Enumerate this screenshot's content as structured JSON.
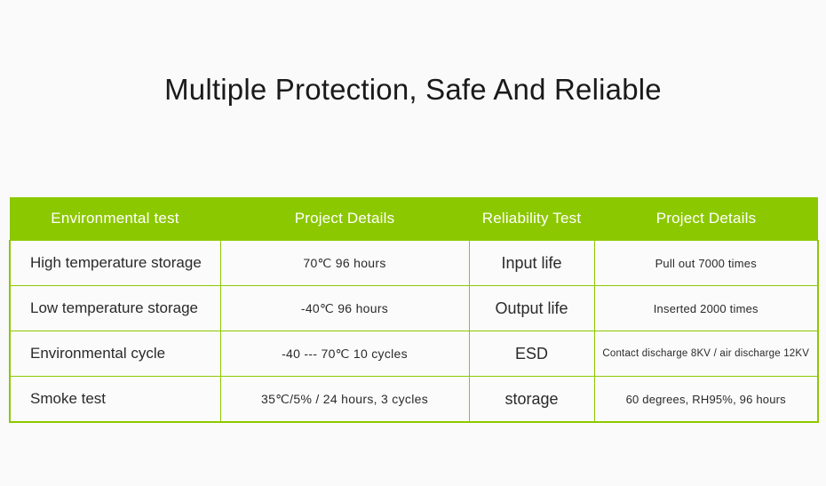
{
  "title": "Multiple Protection, Safe And Reliable",
  "colors": {
    "header_green": "#8cc800",
    "border_green": "#8cc800",
    "page_background": "#fafafa",
    "cell_background": "#fbfbfb",
    "header_text": "#ffffff",
    "body_text": "#2a2a2a",
    "title_text": "#1a1a1a"
  },
  "table": {
    "headers": [
      "Environmental test",
      "Project Details",
      "Reliability Test",
      "Project Details"
    ],
    "rows": [
      {
        "environmental_test": "High temperature storage",
        "environmental_details": "70℃ 96 hours",
        "reliability_test": "Input life",
        "reliability_details": "Pull out 7000 times"
      },
      {
        "environmental_test": "Low temperature storage",
        "environmental_details": "-40℃ 96 hours",
        "reliability_test": "Output life",
        "reliability_details": "Inserted 2000 times"
      },
      {
        "environmental_test": "Environmental cycle",
        "environmental_details": "-40 --- 70℃ 10 cycles",
        "reliability_test": "ESD",
        "reliability_details": "Contact discharge 8KV / air discharge 12KV"
      },
      {
        "environmental_test": "Smoke test",
        "environmental_details": "35℃/5% / 24 hours, 3 cycles",
        "reliability_test": "storage",
        "reliability_details": "60 degrees, RH95%, 96 hours"
      }
    ]
  }
}
